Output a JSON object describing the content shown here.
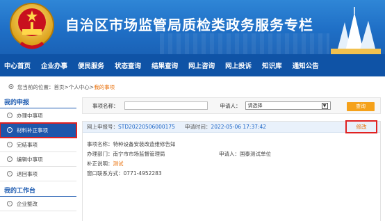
{
  "banner": {
    "title": "自治区市场监管局质检类政务服务专栏"
  },
  "nav": [
    "中心首页",
    "企业办事",
    "便民服务",
    "状态查询",
    "结果查询",
    "网上咨询",
    "网上投诉",
    "知识库",
    "通知公告"
  ],
  "breadcrumb": {
    "prefix": "您当前的位置：",
    "home": "首页",
    "sep1": " > ",
    "center": "个人中心",
    "sep2": " > ",
    "current": "我的事项"
  },
  "sidebar": {
    "section1": "我的申报",
    "items1": [
      "办理中事项",
      "材料补正事项",
      "完结事项",
      "编辑中事项",
      "退回事项"
    ],
    "active_index": 1,
    "section2": "我的工作台",
    "items2": [
      "企业整改"
    ]
  },
  "filter": {
    "name_label": "事项名称：",
    "name_value": "",
    "applicant_label": "申请人：",
    "applicant_selected": "请选择",
    "query_label": "查询"
  },
  "record": {
    "no_label": "网上申报号：",
    "no_value": "STD20220506000175",
    "time_label": "申请时间：",
    "time_value": "2022-05-06 17:37:42",
    "edit_label": "修改",
    "item_name": "事项名称：特种设备安装改造维修告知",
    "dept_label": "办理部门：",
    "dept_value": "南宁市市场监督管理局",
    "applicant_label": "申请人：",
    "applicant_value": "国泰测试单位",
    "note_label": "补正说明：",
    "note_value": "测试",
    "phone": "窗口联系方式：0771-4952283"
  },
  "colors": {
    "nav_bg": "#0f53a6",
    "banner": "#2f86d6",
    "active": "#1e56ab",
    "highlight": "#e02121",
    "accent": "#e96b00",
    "query_btn": "#f5a11a"
  }
}
